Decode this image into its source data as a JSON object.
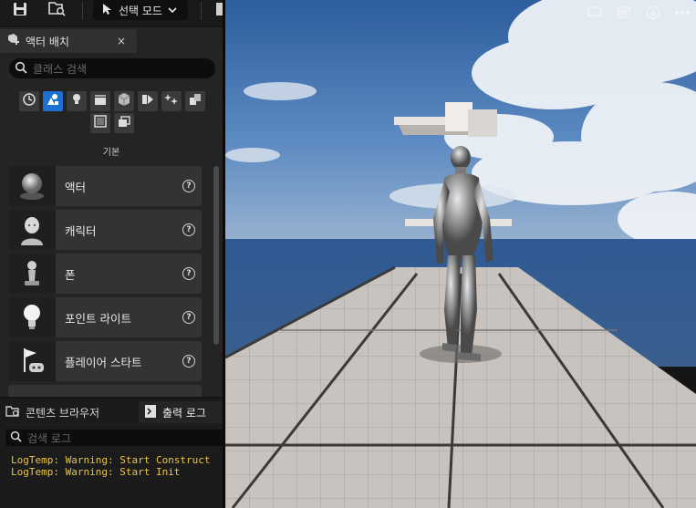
{
  "toolbar": {
    "mode_label": "선택 모드"
  },
  "place_actors": {
    "tab_label": "액터 배치",
    "close_glyph": "×",
    "search_placeholder": "클래스 검색",
    "section_label": "기본",
    "categories": [
      {
        "icon": "clock-icon",
        "active": false
      },
      {
        "icon": "shapes-icon",
        "active": true
      },
      {
        "icon": "lightbulb-icon",
        "active": false
      },
      {
        "icon": "clapperboard-icon",
        "active": false
      },
      {
        "icon": "cube-icon",
        "active": false
      },
      {
        "icon": "media-icon",
        "active": false
      },
      {
        "icon": "effects-icon",
        "active": false
      },
      {
        "icon": "volume-icon",
        "active": false
      },
      {
        "icon": "frame-icon",
        "active": false
      },
      {
        "icon": "stack-icon",
        "active": false
      }
    ],
    "items": [
      {
        "label": "액터",
        "icon": "actor-sphere-icon"
      },
      {
        "label": "캐릭터",
        "icon": "character-icon"
      },
      {
        "label": "폰",
        "icon": "pawn-icon"
      },
      {
        "label": "포인트 라이트",
        "icon": "point-light-icon"
      },
      {
        "label": "플레이어 스타트",
        "icon": "player-start-icon"
      }
    ],
    "help_glyph": "?"
  },
  "bottom": {
    "tab_content_browser": "콘텐츠 브라우저",
    "tab_output_log": "출력 로그",
    "log_search_placeholder": "검색 로그",
    "log_lines": [
      "LogTemp: Warning: Start Construct",
      "LogTemp: Warning: Start Init"
    ]
  },
  "colors": {
    "accent": "#1d6fd1",
    "log_warning": "#e8c54a"
  }
}
